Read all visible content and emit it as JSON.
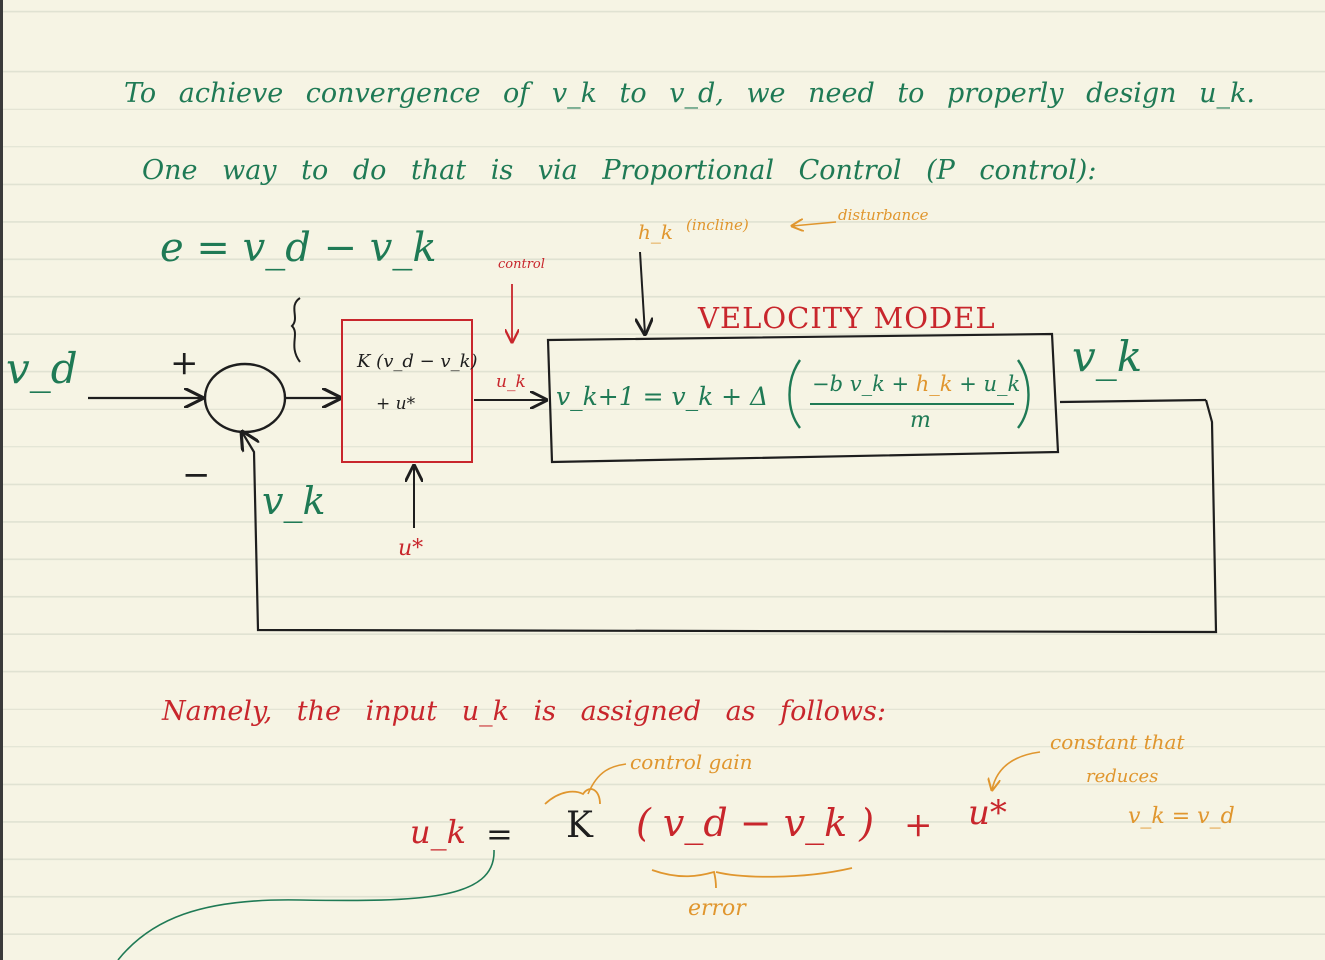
{
  "colors": {
    "green": "#1f7a55",
    "red": "#c8262c",
    "orange": "#e0962e",
    "ink": "#1e1e1e",
    "paper": "#f6f4e4"
  },
  "intro": {
    "line1": "To achieve convergence of v_k to v_d, we need to properly design u_k.",
    "line2": "One way to do that is via Proportional Control (P control):"
  },
  "diagram": {
    "error_def": "e = v_d − v_k",
    "input_label": "v_d",
    "plus_sign": "+",
    "minus_sign": "−",
    "feedback_label": "v_k",
    "controller": {
      "line1": "K (v_d − v_k)",
      "line2": "+ u*"
    },
    "control_label": "control",
    "control_signal": "u_k",
    "u_star_input": "u*",
    "disturbance": {
      "symbol": "h_k",
      "note": "(incline)",
      "label": "disturbance"
    },
    "model_title": "VELOCITY MODEL",
    "model_eq": {
      "lhs": "v_k+1 = v_k + Δ",
      "num_part1": "−b v_k +",
      "num_part2": "h_k",
      "num_part3": "+ u_k",
      "denominator": "m"
    },
    "output_label": "v_k"
  },
  "namely": {
    "sentence": "Namely, the input u_k is assigned as follows:",
    "lhs": "u_k",
    "eq": "=",
    "gain": "K",
    "error_term": "( v_d − v_k )",
    "plus": "+",
    "u_star": "u*",
    "annot_gain": "control gain",
    "annot_error": "error",
    "annot_const_line1": "constant that",
    "annot_const_line2": "reduces",
    "annot_const_line3": "v_k = v_d"
  }
}
